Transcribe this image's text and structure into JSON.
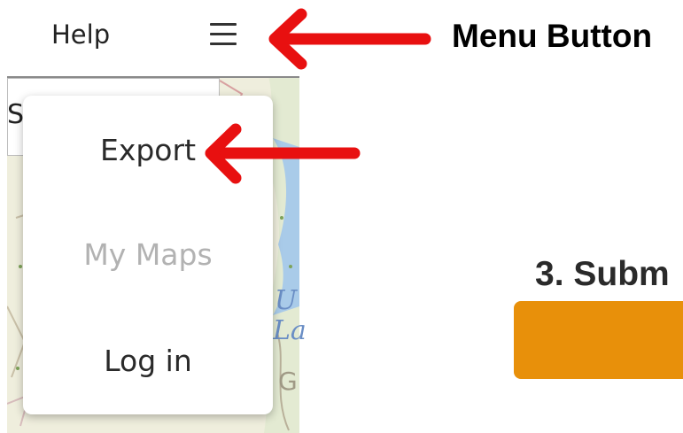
{
  "header": {
    "help_link": "Help",
    "menu_button_icon": "hamburger-menu-icon"
  },
  "search": {
    "visible_text": "S"
  },
  "dropdown_menu": {
    "items": [
      {
        "label": "Export",
        "enabled": true
      },
      {
        "label": "My Maps",
        "enabled": false
      },
      {
        "label": "Log in",
        "enabled": true
      }
    ]
  },
  "map": {
    "water_label_fragments": [
      "U",
      "La"
    ],
    "terrain_label_fragment": "G"
  },
  "annotations": {
    "menu_button_callout": "Menu Button",
    "arrow_color": "#e81010"
  },
  "main": {
    "step_heading": "3. Subm",
    "submit_button_color": "#e8900a"
  }
}
